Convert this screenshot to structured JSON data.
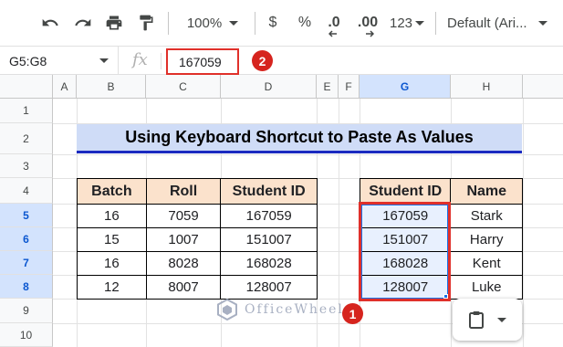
{
  "toolbar": {
    "zoom": "100%",
    "currency": "$",
    "percent": "%",
    "decrease_decimal": ".0",
    "increase_decimal": ".00",
    "number_format": "123",
    "font": "Default (Ari..."
  },
  "formula_bar": {
    "namebox": "G5:G8",
    "fx": "fx",
    "value": "167059"
  },
  "columns": [
    "A",
    "B",
    "C",
    "D",
    "E",
    "F",
    "G",
    "H"
  ],
  "rows": [
    "1",
    "2",
    "3",
    "4",
    "5",
    "6",
    "7",
    "8",
    "9",
    "10"
  ],
  "title": "Using Keyboard Shortcut to Paste As Values",
  "table1": {
    "headers": [
      "Batch",
      "Roll",
      "Student ID"
    ],
    "rows": [
      [
        "16",
        "7059",
        "167059"
      ],
      [
        "15",
        "1007",
        "151007"
      ],
      [
        "16",
        "8028",
        "168028"
      ],
      [
        "12",
        "8007",
        "128007"
      ]
    ]
  },
  "table2": {
    "headers": [
      "Student ID",
      "Name"
    ],
    "rows": [
      [
        "167059",
        "Stark"
      ],
      [
        "151007",
        "Harry"
      ],
      [
        "168028",
        "Kent"
      ],
      [
        "128007",
        "Luke"
      ]
    ]
  },
  "badges": {
    "one": "1",
    "two": "2"
  },
  "watermark": "OfficeWheel",
  "colors": {
    "header_fill": "#fbe2cc",
    "title_fill": "#cfdcf7",
    "title_underline": "#1a2ac0",
    "highlight_border": "#e0302a",
    "selection_fill": "#e8f0fe"
  }
}
